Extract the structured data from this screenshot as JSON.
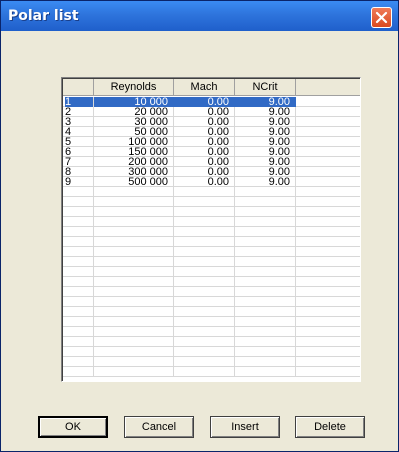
{
  "window": {
    "title": "Polar list"
  },
  "grid": {
    "columns": [
      "",
      "Reynolds",
      "Mach",
      "NCrit",
      ""
    ],
    "rows": [
      [
        "1",
        "10 000",
        "0.00",
        "9.00"
      ],
      [
        "2",
        "20 000",
        "0.00",
        "9.00"
      ],
      [
        "3",
        "30 000",
        "0.00",
        "9.00"
      ],
      [
        "4",
        "50 000",
        "0.00",
        "9.00"
      ],
      [
        "5",
        "100 000",
        "0.00",
        "9.00"
      ],
      [
        "6",
        "150 000",
        "0.00",
        "9.00"
      ],
      [
        "7",
        "200 000",
        "0.00",
        "9.00"
      ],
      [
        "8",
        "300 000",
        "0.00",
        "9.00"
      ],
      [
        "9",
        "500 000",
        "0.00",
        "9.00"
      ]
    ],
    "selected_row": 0
  },
  "buttons": {
    "ok": "OK",
    "cancel": "Cancel",
    "insert": "Insert",
    "delete": "Delete"
  },
  "colors": {
    "titlebar": "#2e74dc",
    "selection": "#316ac5",
    "close": "#d9491f",
    "face": "#ece9d8"
  },
  "icons": {
    "close": "close-icon"
  }
}
